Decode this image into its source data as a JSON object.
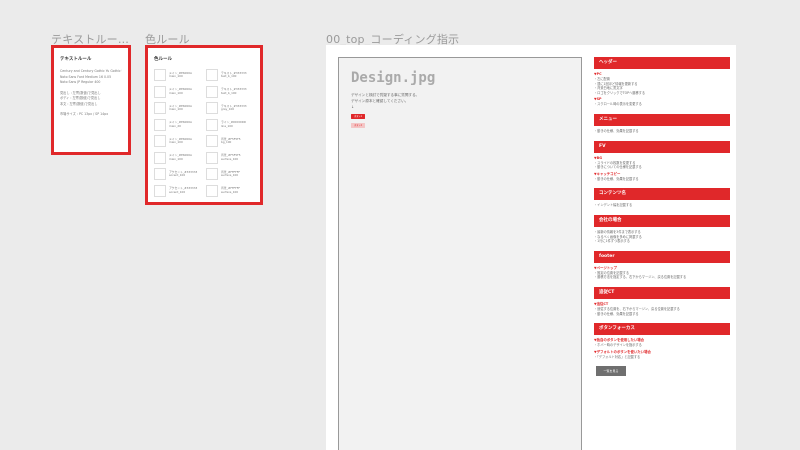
{
  "artboards": {
    "text_rules_title": "テキストルー…",
    "color_rules_title": "色ルール",
    "design_title": "00_top_コーディング指示"
  },
  "text_rules": {
    "heading": "テキストルール",
    "lines": [
      "Century and Century Gothic  Yu Gothic UI bold",
      "Noto Sans Font  Medium 16 0.05",
      "Noto Sans JP  Regular 400",
      "",
      "見出し : 左寄(数値)で見出し",
      "ボディ : 左寄(数値)で見出し",
      "本文 : 左寄(数値)で見出し",
      "",
      "市場サイズ : PC 13px / SP 14px"
    ]
  },
  "color_rules": {
    "heading": "色ルール",
    "swatches": [
      [
        "メイン_#E6000A",
        "main_100"
      ],
      [
        "テキスト_#333333",
        "text_b_100"
      ],
      [
        "メイン_#E6000A",
        "main_100"
      ],
      [
        "テキスト_#333333",
        "text_b_100"
      ],
      [
        "メイン_#E6000A",
        "main_100"
      ],
      [
        "テキスト_#333333",
        "gray_100"
      ],
      [
        "メイン_#E6000A",
        "main_20"
      ],
      [
        "ライン_#DDDDDD",
        "line_100"
      ],
      [
        "メイン_#E6000A",
        "main_100"
      ],
      [
        "背景_#F5F5F5",
        "bg_100"
      ],
      [
        "メイン_#E6000A",
        "main_100"
      ],
      [
        "背景_#F5F5F5",
        "surface_100"
      ],
      [
        "アクセント_#333333",
        "accent_100"
      ],
      [
        "背景_#FFFFFF",
        "surface_100"
      ],
      [
        "アクセント_#333333",
        "accent_100"
      ],
      [
        "背景_#FFFFFF",
        "surface_100"
      ]
    ]
  },
  "design": {
    "title": "Design.jpg",
    "lines": [
      "デザインと検討で質疑する事に質問する。",
      "デザイン原本と確認してください。",
      "↓"
    ],
    "buttons": [
      "ボタン1",
      "ボタン2"
    ]
  },
  "spec": {
    "sections": [
      {
        "title": "ヘッダー",
        "blocks": [
          {
            "sub": "▼PC",
            "items": [
              "・左に配置",
              "・週に1回ほど情報を更新する",
              "・背景白地に黒文字",
              "・ロゴをクリックでTOPへ遷移する"
            ]
          },
          {
            "sub": "▼SP",
            "items": [
              "・スクロール時の表示を変更する"
            ]
          }
        ]
      },
      {
        "title": "メニュー",
        "blocks": [
          {
            "sub": "",
            "items": [
              "・動きの仕様、効果を記載する"
            ]
          }
        ]
      },
      {
        "title": "FV",
        "blocks": [
          {
            "sub": "▼BG",
            "items": [
              "・スライドの枚数を変更する",
              "・動きについての仕様を記載する"
            ]
          },
          {
            "sub": "▼キャッチコピー",
            "items": [
              "・動きの仕様、効果を記載する"
            ]
          }
        ]
      },
      {
        "title": "コンテンツ名",
        "blocks": [
          {
            "sub": "",
            "items": [
              "・インデント幅を記載する"
            ]
          }
        ]
      },
      {
        "title": "会社の場合",
        "blocks": [
          {
            "sub": "",
            "items": [
              "・最新の情報を3件まで表示する",
              "・なるべく画像を多めに掲載する",
              "・1行に1件ずつ表示する"
            ]
          }
        ]
      },
      {
        "title": "footer",
        "blocks": [
          {
            "sub": "▼ページトップ",
            "items": [
              "・固定の位置を記載する",
              "・遷移方法を指定する、右下からマージン、戻る位置を記載する"
            ]
          }
        ]
      },
      {
        "title": "追従CT",
        "blocks": [
          {
            "sub": "▼追従CT",
            "items": [
              "・追従する位置を、右下からマージン、戻る位置を記載する",
              "・動きの仕様、効果を記載する"
            ]
          }
        ]
      },
      {
        "title": "ボタンフォーカス",
        "blocks": [
          {
            "sub": "▼独自のボタンを使用したい場合",
            "items": [
              "・ホバー時のデザインを指示する"
            ]
          },
          {
            "sub": "▼デフォルトのボタンを使いたい場合",
            "items": [
              "・「デフォルト対応」と記載する"
            ]
          }
        ]
      }
    ],
    "dark_button": "一覧を見る"
  }
}
